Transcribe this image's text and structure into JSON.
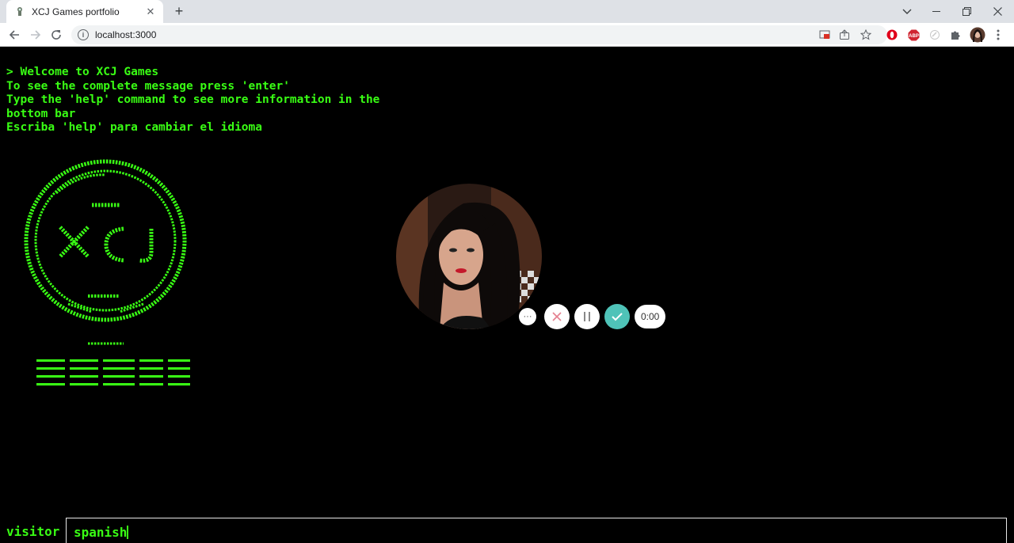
{
  "browser": {
    "tab_title": "XCJ Games portfolio",
    "tab_close": "✕",
    "new_tab": "+",
    "url": "localhost:3000",
    "window_controls": {
      "chevron": "⌄",
      "minimize": "—",
      "maximize": "❐",
      "close": "✕"
    },
    "extensions": [
      "cast-icon",
      "share-icon",
      "star-icon",
      "opera-icon",
      "adblock-icon",
      "extension-icon",
      "puzzle-icon",
      "profile-avatar",
      "menu-icon"
    ],
    "extension_labels": {
      "abp": "ABP"
    }
  },
  "terminal": {
    "lines": [
      "> Welcome to XCJ Games",
      "To see the complete message press 'enter'",
      "Type the 'help' command to see more information in the bottom bar",
      "Escriba 'help' para cambiar el idioma"
    ],
    "ascii_logo": "xcj-games-ascii-logo",
    "text_color": "#39ff14"
  },
  "recorder": {
    "timer": "0:00",
    "more": "···",
    "accent": "#4fc3b8"
  },
  "prompt": {
    "label": "visitor",
    "value": "spanish"
  }
}
